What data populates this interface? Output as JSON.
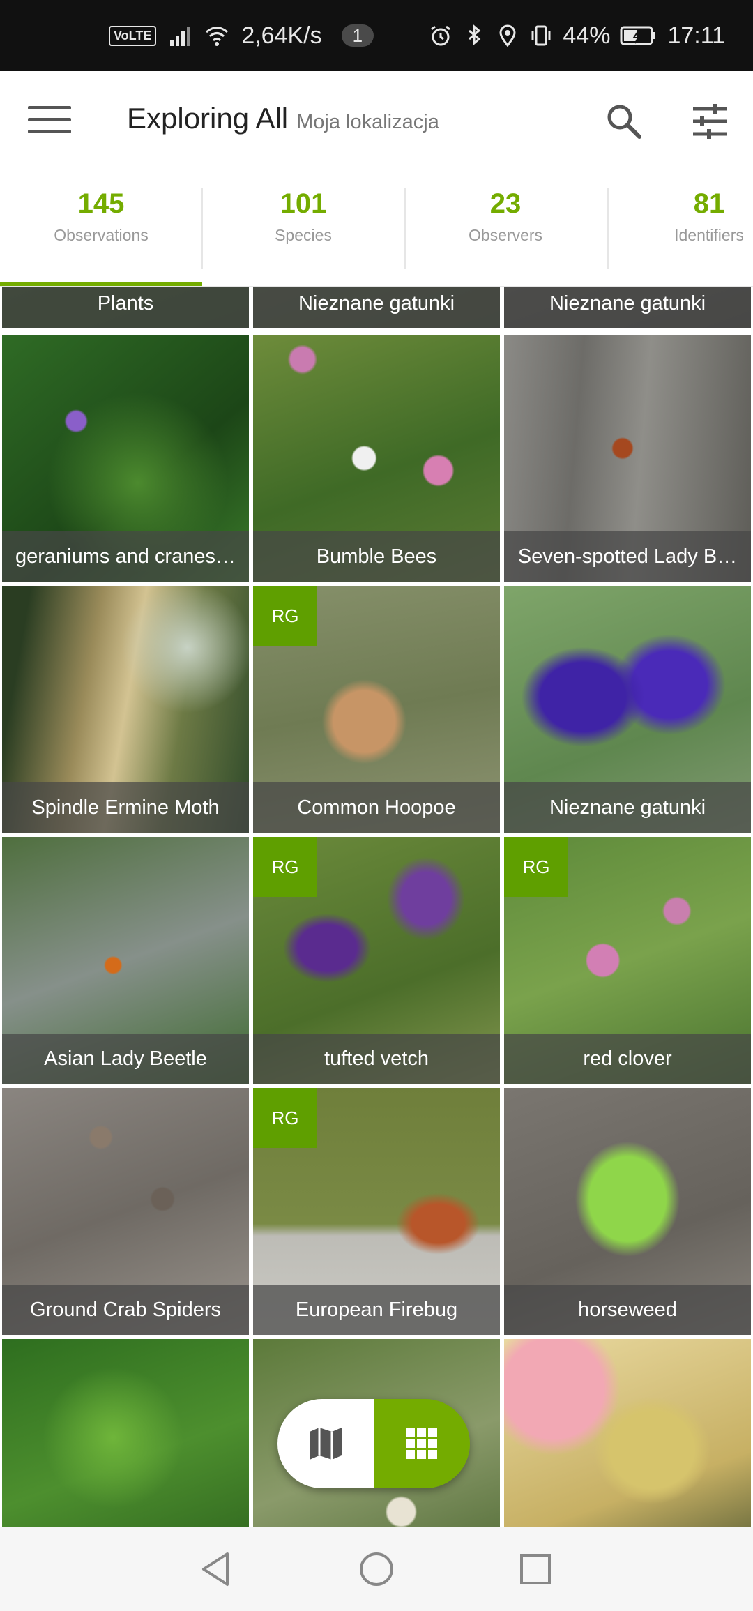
{
  "status_bar": {
    "volte": "VoLTE",
    "net_speed": "2,64K/s",
    "notification_count": "1",
    "battery": "44%",
    "time": "17:11"
  },
  "app_bar": {
    "title": "Exploring All",
    "subtitle": "Moja lokalizacja"
  },
  "tabs": [
    {
      "count": "145",
      "label": "Observations"
    },
    {
      "count": "101",
      "label": "Species"
    },
    {
      "count": "23",
      "label": "Observers"
    },
    {
      "count": "81",
      "label": "Identifiers"
    }
  ],
  "grid": {
    "badge_text": "RG",
    "cells": [
      {
        "label": "Plants",
        "rg": false
      },
      {
        "label": "Nieznane gatunki",
        "rg": false
      },
      {
        "label": "Nieznane gatunki",
        "rg": false
      },
      {
        "label": "geraniums and cranes…",
        "rg": false
      },
      {
        "label": "Bumble Bees",
        "rg": false
      },
      {
        "label": "Seven-spotted Lady B…",
        "rg": false
      },
      {
        "label": "Spindle Ermine Moth",
        "rg": false
      },
      {
        "label": "Common Hoopoe",
        "rg": true
      },
      {
        "label": "Nieznane gatunki",
        "rg": false
      },
      {
        "label": "Asian Lady Beetle",
        "rg": false
      },
      {
        "label": "tufted vetch",
        "rg": true
      },
      {
        "label": "red clover",
        "rg": true
      },
      {
        "label": "Ground Crab Spiders",
        "rg": false
      },
      {
        "label": "European Firebug",
        "rg": true
      },
      {
        "label": "horseweed",
        "rg": false
      },
      {
        "label": "",
        "rg": false
      },
      {
        "label": "",
        "rg": false
      },
      {
        "label": "",
        "rg": false
      }
    ]
  },
  "colors": {
    "accent": "#74ac00",
    "badge": "#5f9f00",
    "status_bar": "#111111"
  },
  "icons": [
    "menu-icon",
    "search-icon",
    "filter-icon",
    "map-icon",
    "grid-icon",
    "back-icon",
    "home-icon",
    "recents-icon"
  ]
}
